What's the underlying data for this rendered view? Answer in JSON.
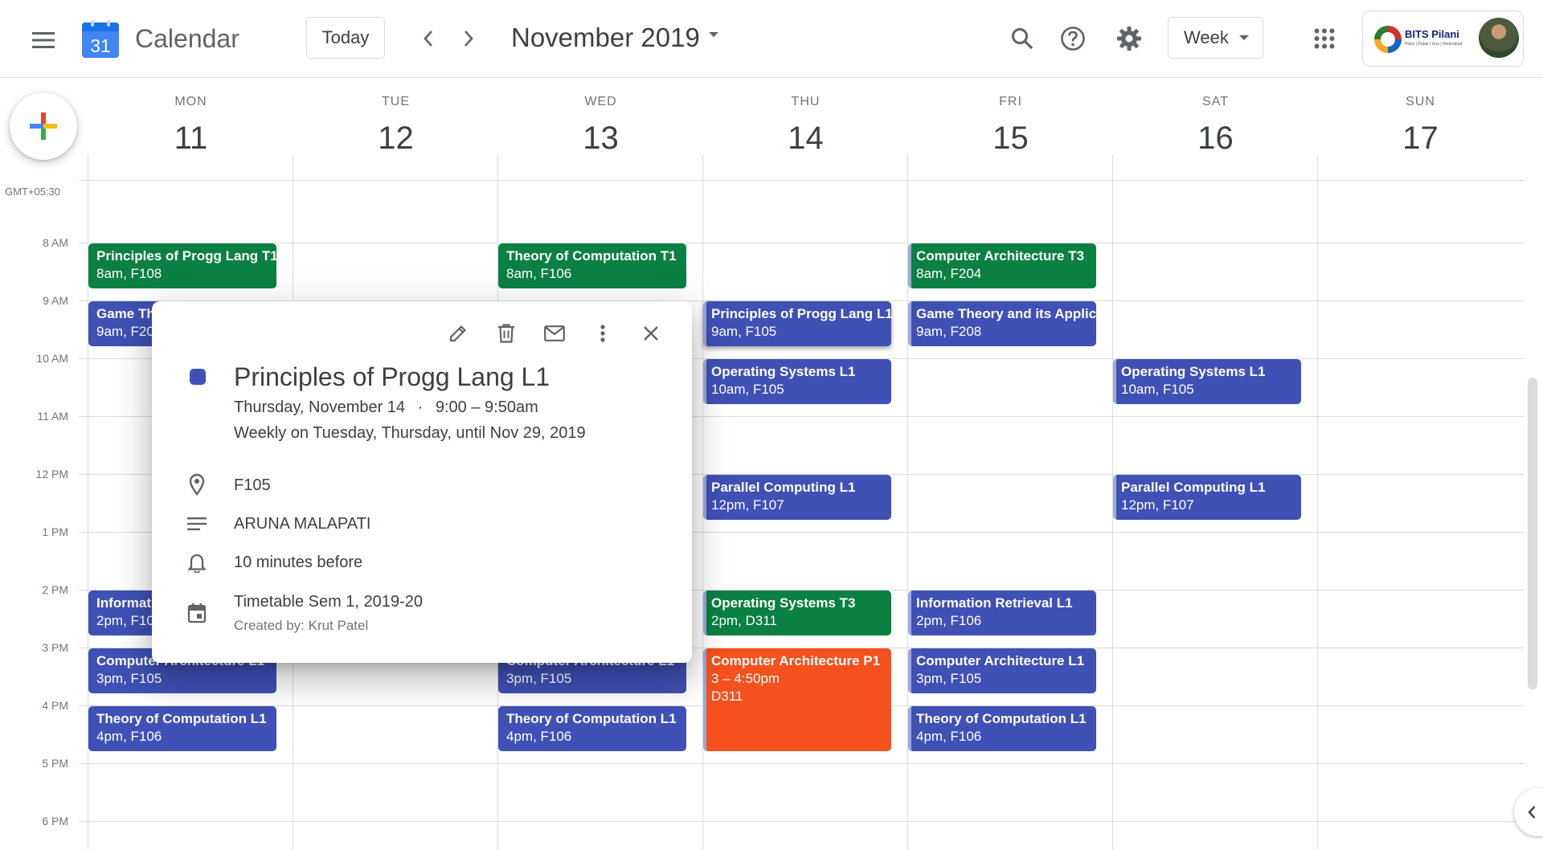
{
  "header": {
    "menu_icon": "hamburger-menu-icon",
    "logo_day": "31",
    "app_title": "Calendar",
    "today_label": "Today",
    "month_label": "November 2019",
    "view_label": "Week",
    "org_name": "BITS Pilani",
    "org_campus": "Pilani | Dubai | Goa | Hyderabad"
  },
  "timezone": "GMT+05:30",
  "days": [
    {
      "name": "MON",
      "num": "11"
    },
    {
      "name": "TUE",
      "num": "12"
    },
    {
      "name": "WED",
      "num": "13"
    },
    {
      "name": "THU",
      "num": "14"
    },
    {
      "name": "FRI",
      "num": "15"
    },
    {
      "name": "SAT",
      "num": "16"
    },
    {
      "name": "SUN",
      "num": "17"
    }
  ],
  "hours": [
    "8 AM",
    "9 AM",
    "10 AM",
    "11 AM",
    "12 PM",
    "1 PM",
    "2 PM",
    "3 PM",
    "4 PM",
    "5 PM",
    "6 PM"
  ],
  "events": [
    {
      "title": "Principles of Progg Lang T1",
      "detail": "8am, F108"
    },
    {
      "title": "Game Th",
      "detail": "9am, F20"
    },
    {
      "title": "Informat",
      "detail": "2pm, F10"
    },
    {
      "title": "Computer Architecture L1",
      "detail": "3pm, F105"
    },
    {
      "title": "Theory of Computation L1",
      "detail": "4pm, F106"
    },
    {
      "title": "Theory of Computation T1",
      "detail": "8am, F106"
    },
    {
      "title": "Computer Architecture L1",
      "detail": "3pm, F105"
    },
    {
      "title": "Theory of Computation L1",
      "detail": "4pm, F106"
    },
    {
      "title": "Principles of Progg Lang L1",
      "detail": "9am, F105"
    },
    {
      "title": "Operating Systems L1",
      "detail": "10am, F105"
    },
    {
      "title": "Parallel Computing L1",
      "detail": "12pm, F107"
    },
    {
      "title": "Operating Systems T3",
      "detail": "2pm, D311"
    },
    {
      "title": "Computer Architecture P1",
      "detail": "3 – 4:50pm",
      "room": "D311"
    },
    {
      "title": "Computer Architecture T3",
      "detail": "8am, F204"
    },
    {
      "title": "Game Theory and its Applic",
      "detail": "9am, F208"
    },
    {
      "title": "Information Retrieval L1",
      "detail": "2pm, F106"
    },
    {
      "title": "Computer Architecture L1",
      "detail": "3pm, F105"
    },
    {
      "title": "Theory of Computation L1",
      "detail": "4pm, F106"
    },
    {
      "title": "Operating Systems L1",
      "detail": "10am, F105"
    },
    {
      "title": "Parallel Computing L1",
      "detail": "12pm, F107"
    }
  ],
  "popup": {
    "title": "Principles of Progg Lang L1",
    "date": "Thursday, November 14",
    "separator": "·",
    "time": "9:00 – 9:50am",
    "recurrence": "Weekly on Tuesday, Thursday, until Nov 29, 2019",
    "location": "F105",
    "description": "ARUNA MALAPATI",
    "reminder": "10 minutes before",
    "calendar": "Timetable Sem 1, 2019-20",
    "created_by": "Created by: Krut Patel"
  },
  "colors": {
    "lavender": "#3f51b5",
    "basil": "#0b8043",
    "tangerine": "#f4511e",
    "accent_blue": "#4285f4"
  }
}
